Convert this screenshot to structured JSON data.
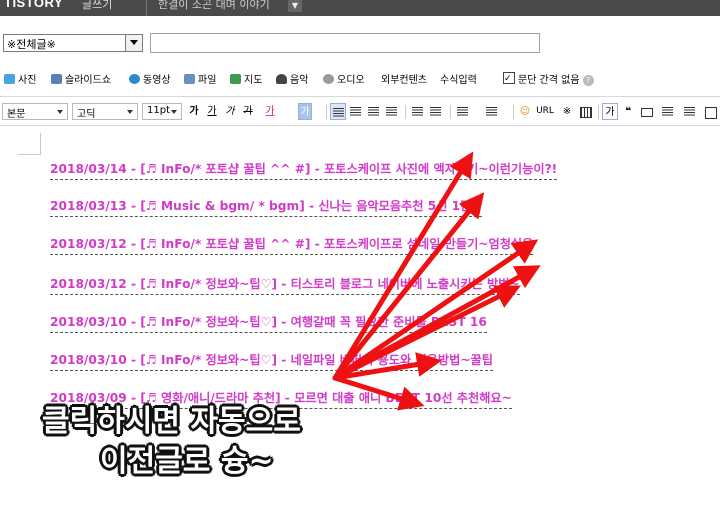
{
  "topbar": {
    "logo": "TISTORY",
    "logo_sub": "글쓰기",
    "blog_title": "한결이 소곤 대며 이야기",
    "dropdown_icon": "chevron-down-icon"
  },
  "category": {
    "selected": "※전체글※",
    "title_value": ""
  },
  "insert_toolbar": {
    "items": [
      "사진",
      "슬라이드쇼",
      "동영상",
      "파일",
      "지도",
      "음악",
      "오디오",
      "외부컨텐츠",
      "수식입력"
    ],
    "checkbox_label": "문단 간격 없음",
    "checkbox_checked": true
  },
  "format_toolbar": {
    "paragraph_style": "본문",
    "font": "고딕",
    "size": "11pt",
    "bold": "가",
    "underline": "가",
    "italic": "가",
    "strike": "가",
    "color": "가",
    "bg": "가",
    "url": "URL",
    "ref": "※",
    "quote": "❝",
    "letter": "가"
  },
  "posts": [
    "2018/03/14 - [♬ InFo/* 포토샵 꿀팁 ^^ #] - 포토스케이프 사진에 액자넣기~이런기능이?!",
    "2018/03/13 - [♬ Music & bgm/ * bgm] - 신나는 음악모음추천 5선 1탄~",
    "2018/03/12 - [♬ InFo/* 포토샵 꿀팁 ^^ #] - 포토스케이프로 섬네일 만들기~엄청쉬움",
    "2018/03/12 - [♬ InFo/* 정보와~팁♡] - 티스토리 블로그 네이버에 노출시키는 방법~",
    "2018/03/10 - [♬ InFo/* 정보와~팁♡] - 여행갈때 꼭 필요한 준비물 BEST 16",
    "2018/03/10 - [♬ InFo/* 정보와~팁♡] - 네일파일 버퍼의 용도와 이용방법~꿀팁",
    "2018/03/09 - [♬ 영화/애니/드라마 추천] - 모르면 대출 애니 BEST 10선 추천해요~"
  ],
  "caption": {
    "line1": "클릭하시면 자동으로",
    "line2": "이전글로 슝~"
  },
  "colors": {
    "link": "#d23ac8",
    "arrow": "#ee1111",
    "topbar": "#4a4a4a"
  }
}
